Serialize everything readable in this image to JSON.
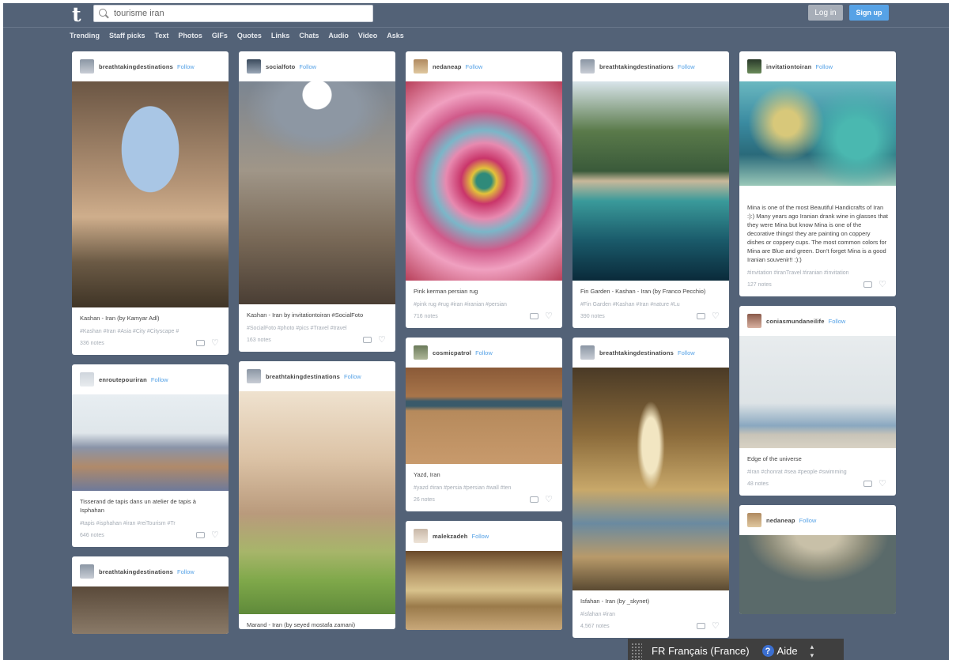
{
  "header": {
    "logo": "t",
    "search_value": "tourisme iran",
    "login_label": "Log in",
    "signup_label": "Sign up"
  },
  "nav": [
    "Trending",
    "Staff picks",
    "Text",
    "Photos",
    "GIFs",
    "Quotes",
    "Links",
    "Chats",
    "Audio",
    "Video",
    "Asks"
  ],
  "post_actions": {
    "follow_label": "Follow"
  },
  "columns": [
    [
      {
        "blog": "breathtakingdestinations",
        "caption": "Kashan - Iran (by Kamyar Adl)",
        "tags": "#Kashan  #Iran  #Asia  #City  #Cityscape  #",
        "notes": "336 notes"
      },
      {
        "blog": "enroutepouriran",
        "caption": "Tisserand de tapis dans un atelier de tapis à Isphahan",
        "tags": "#tapis  #isphahan  #iran  #reiTourism  #Tr",
        "notes": "646 notes"
      },
      {
        "blog": "breathtakingdestinations"
      }
    ],
    [
      {
        "blog": "socialfoto",
        "caption": "Kashan - Iran by invitationtoiran #SocialFoto",
        "tags": "#SocialFoto  #photo  #pics  #Travel  #travel",
        "notes": "163 notes"
      },
      {
        "blog": "breathtakingdestinations",
        "caption": "Marand - Iran (by seyed mostafa zamani)"
      }
    ],
    [
      {
        "blog": "nedaneap",
        "caption": "Pink kerman persian rug",
        "tags": "#pink rug  #rug  #iran  #iranian  #persian",
        "notes": "716 notes"
      },
      {
        "blog": "cosmicpatrol",
        "caption": "Yazd, Iran",
        "tags": "#yazd  #iran  #persia  #persian  #wall  #ten",
        "notes": "26 notes"
      },
      {
        "blog": "malekzadeh"
      }
    ],
    [
      {
        "blog": "breathtakingdestinations",
        "caption": "Fin Garden - Kashan - Iran (by Franco Pecchio)",
        "tags": "#Fin Garden  #Kashan  #Iran  #nature  #Lu",
        "notes": "390 notes"
      },
      {
        "blog": "breathtakingdestinations",
        "caption": "Isfahan - Iran (by _skynet)",
        "tags": "#isfahan  #iran",
        "notes": "4,567 notes"
      }
    ],
    [
      {
        "blog": "invitationtoiran",
        "caption": "Mina is one of the most Beautiful Handicrafts of Iran :):) Many years ago Iranian drank wine in glasses that they were Mina but know Mina is one of the decorative things! they are painting on coppery dishes or coppery cups. The most common colors for Mina are Blue and green. Don't forget Mina is a good Iranian souvenir!! :):)",
        "tags": "#invitation  #iranTravel  #iranian  #invitation",
        "notes": "127 notes"
      },
      {
        "blog": "coniasmundaneilife",
        "caption": "Edge of the universe",
        "tags": "#iran  #chonrat  #sea  #people  #swimming",
        "notes": "48 notes"
      },
      {
        "blog": "nedaneap"
      }
    ]
  ],
  "langbar": {
    "language": "FR Français (France)",
    "help_label": "Aide"
  },
  "colors": {
    "background": "#536277",
    "accent": "#56a2e6",
    "card": "#ffffff"
  },
  "icons": [
    "tumblr-logo-icon",
    "search-icon",
    "reblog-icon",
    "like-icon",
    "help-icon"
  ]
}
